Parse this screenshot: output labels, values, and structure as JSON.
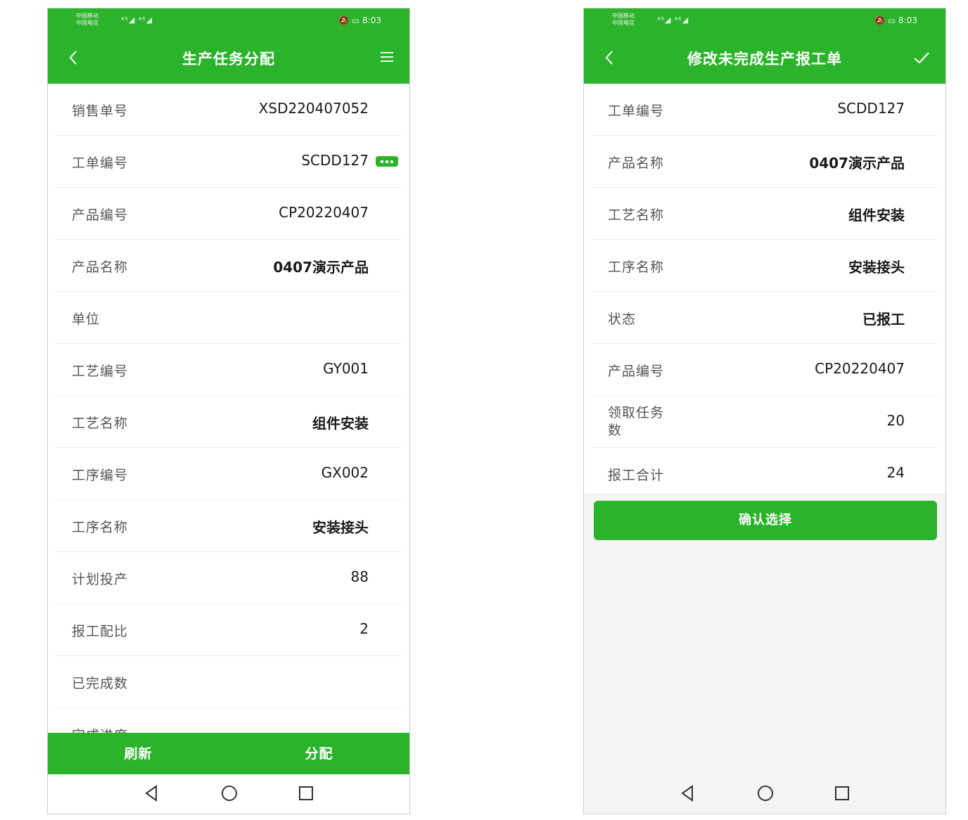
{
  "left": {
    "status": {
      "carrier_lines": [
        "中国移动",
        "中国电信"
      ],
      "signals": "⁴⁶◢ ⁴⁶◢",
      "time": "8:03"
    },
    "title": "生产任务分配",
    "fields": [
      {
        "label": "销售单号",
        "value": "XSD220407052",
        "bold": false
      },
      {
        "label": "工单编号",
        "value": "SCDD127",
        "bold": false,
        "more": true
      },
      {
        "label": "产品编号",
        "value": "CP20220407",
        "bold": false
      },
      {
        "label": "产品名称",
        "value": "0407演示产品",
        "bold": true
      },
      {
        "label": "单位",
        "value": "",
        "bold": false
      },
      {
        "label": "工艺编号",
        "value": "GY001",
        "bold": false
      },
      {
        "label": "工艺名称",
        "value": "组件安装",
        "bold": true
      },
      {
        "label": "工序编号",
        "value": "GX002",
        "bold": false
      },
      {
        "label": "工序名称",
        "value": "安装接头",
        "bold": true
      },
      {
        "label": "计划投产",
        "value": "88",
        "bold": false
      },
      {
        "label": "报工配比",
        "value": "2",
        "bold": false
      },
      {
        "label": "已完成数",
        "value": "",
        "bold": false
      },
      {
        "label": "完成进度",
        "value": "",
        "bold": false
      }
    ],
    "buttons": {
      "refresh": "刷新",
      "assign": "分配"
    }
  },
  "right": {
    "status": {
      "carrier_lines": [
        "中国移动",
        "中国电信"
      ],
      "signals": "⁴⁶◢ ⁴⁶◢",
      "time": "8:03"
    },
    "title": "修改未完成生产报工单",
    "fields": [
      {
        "label": "工单编号",
        "value": "SCDD127",
        "bold": false
      },
      {
        "label": "产品名称",
        "value": "0407演示产品",
        "bold": true
      },
      {
        "label": "工艺名称",
        "value": "组件安装",
        "bold": true
      },
      {
        "label": "工序名称",
        "value": "安装接头",
        "bold": true
      },
      {
        "label": "状态",
        "value": "已报工",
        "bold": true
      },
      {
        "label": "产品编号",
        "value": "CP20220407",
        "bold": false
      },
      {
        "label": "领取任务数",
        "value": "20",
        "bold": false,
        "two_line": true
      },
      {
        "label": "报工合计",
        "value": "24",
        "bold": false
      }
    ],
    "confirm_label": "确认选择"
  },
  "colors": {
    "accent": "#2cb32c",
    "row_divider": "#efefef",
    "label": "#555555",
    "value": "#1a1a1a"
  },
  "icons": [
    "back-arrow-icon",
    "menu-icon",
    "check-icon",
    "more-dots-icon",
    "nav-back-triangle-icon",
    "nav-home-circle-icon",
    "nav-recents-square-icon"
  ]
}
